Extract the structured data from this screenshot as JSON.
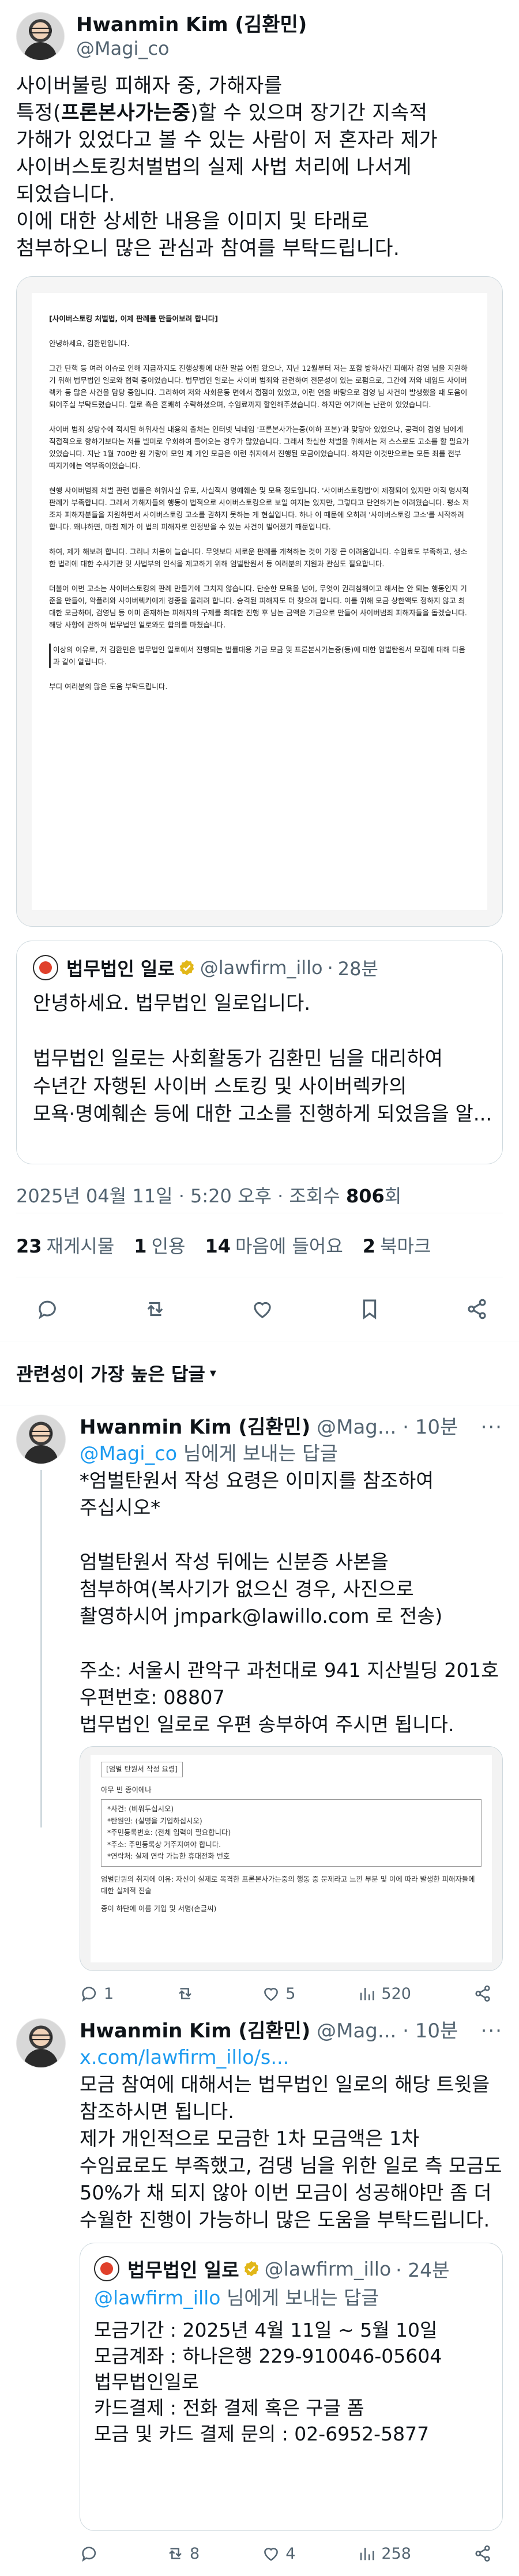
{
  "author": {
    "name": "Hwanmin Kim (김환민)",
    "handle": "@Magi_co"
  },
  "post": {
    "lines": [
      "사이버불링 피해자 중, 가해자를",
      "특정(",
      "가해가 있었다고 볼 수 있는 사람이 저 혼자라 제가",
      "사이버스토킹처벌법의 실제 사법 처리에 나서게",
      "되었습니다.",
      "이에 대한 상세한 내용을 이미지 및 타래로",
      "첨부하오니 많은 관심과 참여를 부탁드립니다."
    ],
    "bold_part": "프론본사가는중",
    "line2_rest": ")할 수 있으며 장기간 지속적"
  },
  "document": {
    "title": "[사이버스토킹 처벌법, 이제 판례를 만들어보려 합니다]",
    "paragraphs": [
      "안녕하세요, 김환민입니다.",
      "그간 탄핵 등 여러 이슈로 인해 지금까지도 진행상황에 대한 말씀 어렵 왔으나, 지난 12월부터 저는 포함 방화사건 피해자 검영 님을 지원하기 위해 법무법인 일로와 협력 중이었습니다. 법무법인 일로는 사이버 범죄와 관련하여 전문성이 있는 로펌으로, 그간에 저와 네임드 사이버렉카 등 많은 사건을 담당 중입니다. 그리하여 저와 사회운동 면에서 접점이 있었고, 이런 연을 바탕으로 검영 님 사건이 발생했을 때 도움이 되어주실 부탁드렸습니다. 일로 측은 흔쾌히 수락하셨으며, 수임료까지 할인해주셨습니다. 하지만 여기에는 난관이 있었습니다.",
      "사이버 범죄 상당수에 적시된 허위사실 내용의 출처는 인터넷 닉네임 '프론본사가는중(이하 프본)'과 맞닿아 있었으나, 공격이 검영 님에게 직접적으로 향하기보다는 저를 빌미로 우회하여 들어오는 경우가 많았습니다. 그래서 확실한 처벌을 위해서는 저 스스로도 고소를 할 필요가 있었습니다. 지난 1월 700만 원 가량이 모인 제 개인 모금은 이런 취지에서 진행된 모금이었습니다. 하지만 이것만으로는 모든 죄를 전부 따지기에는 역부족이었습니다.",
      "현행 사이버범죄 처벌 관련 법률은 허위사실 유포, 사실적시 명예훼손 및 모욕 정도입니다. '사이버스토킹법'이 제정되어 있지만 아직 명시적 판례가 부족합니다. 그래서 가해자들의 행동이 법적으로 사이버스토킹으로 보일 여지는 있지만, 그렇다고 단언하기는 어려웠습니다. 평소 저조차 피해자분들을 지원하면서 사이버스토킹 고소를 권하지 못하는 게 현실입니다. 하나 이 때문에 오히려 '사이버스토킹 고소'를 시작하려 합니다. 왜냐하면, 마침 제가 이 법의 피해자로 인정받을 수 있는 사건이 벌어졌기 때문입니다.",
      "하여, 제가 해보려 합니다. 그러나 처음이 늘습니다. 무엇보다 새로운 판례를 개척하는 것이 가장 큰 어려움입니다. 수임료도 부족하고, 생소한 법리에 대한 수사기관 및 사법부의 인식을 제고하기 위해 엄벌탄원서 등 여러분의 지원과 관심도 필요합니다.",
      "더불어 이번 고소는 사이버스토킹의 판례 만들기에 그치지 않습니다. 단순한 모욕을 넘어, 무엇이 권리침해이고 해서는 안 되는 행동인지 기준을 만들어, 악플러와 사이버렉카에게 경종을 울리려 합니다. 승격된 피해자도 더 찾으려 합니다. 이를 위해 모금 상한액도 정하지 않고 최대한 모금하며, 검영님 등 이미 존재하는 피해자의 구제를 최대한 진행 후 남는 금액은 기금으로 만들어 사이버범죄 피해자들을 돕겠습니다. 해당 사항에 관하여 법무법인 일로와도 합의를 마쳤습니다.",
      "이상의 이유로, 저 김환민은 법무법인 일로에서 진행되는 법률대응 기금 모금 및 프론본사가는중(등)에 대한 엄벌탄원서 모집에 대해 다음과 같이 알립니다.",
      "부디 여러분의 많은 도움 부탁드립니다."
    ]
  },
  "quote_tweet": {
    "name": "법무법인 일로",
    "handle": "@lawfirm_illo",
    "time": "28분",
    "lines": [
      "안녕하세요. 법무법인 일로입니다.",
      "법무법인 일로는 사회활동가 김환민 님을 대리하여",
      "수년간 자행된 사이버 스토킹 및 사이버렉카의",
      "모욕·명예훼손 등에 대한 고소를 진행하게 되었음을 알..."
    ]
  },
  "timestamp": {
    "text": "2025년 04월 11일 · 5:20 오후 · 조회수 ",
    "views": "806",
    "views_suffix": "회"
  },
  "stats": [
    {
      "count": "23",
      "label": "재게시물"
    },
    {
      "count": "1",
      "label": "인용"
    },
    {
      "count": "14",
      "label": "마음에 들어요"
    },
    {
      "count": "2",
      "label": "북마크"
    }
  ],
  "sort_label": "관련성이 가장 높은 답글",
  "replies": [
    {
      "name": "Hwanmin Kim (김환민)",
      "handle": "@Mag...",
      "time": "· 10분",
      "reply_to": "@Magi_co",
      "reply_suffix": " 님에게 보내는 답글",
      "lines": [
        "*엄벌탄원서 작성 요령은 이미지를 참조하여",
        "주십시오*",
        "",
        "엄벌탄원서 작성 뒤에는 신분증 사본을",
        "첨부하여(복사기가 없으신 경우, 사진으로",
        "촬영하시어 jmpark@lawillo.com 로 전송)",
        "",
        "주소: 서울시 관악구 과천대로 941 지산빌딩 201호",
        "우편번호: 08807",
        "법무법인 일로로 우편 송부하여 주시면 됩니다."
      ],
      "form": {
        "title": "[엄벌 탄원서 작성 요령]",
        "lines": [
          "아무 빈 종이에나",
          "*사건: (비워두십시오)",
          "*탄원인: (실명을 기입하십시오)",
          "*주민등록번호: (전체 입력이 필요합니다)",
          "*주소: 주민등록상 거주지여야 합니다.",
          "*연락처: 실제 연락 가능한 휴대전화 번호",
          "엄벌탄원의 취지에 이유: 자신이 실제로 목격한 프론본사가는중의 행동 중 문제라고 느낀 부분 및 이에 따라 발생한 피해자들에 대한 실제적 진술",
          "종이 하단에 이름 기입 및 서명(손글씨)"
        ]
      },
      "actions": {
        "reply": "1",
        "retweet": "",
        "like": "5",
        "views": "520"
      }
    },
    {
      "name": "Hwanmin Kim (김환민)",
      "handle": "@Mag...",
      "time": "· 10분",
      "link": "x.com/lawfirm_illo/s...",
      "lines": [
        "모금 참여에 대해서는 법무법인 일로의 해당 트윗을",
        "참조하시면 됩니다.",
        "제가 개인적으로 모금한 1차 모금액은 1차",
        "수임료로도 부족했고, 검댕 님을 위한 일로 측 모금도",
        "50%가 채 되지 않아 이번 모금이 성공해야만 좀 더",
        "수월한 진행이 가능하니 많은 도움을 부탁드립니다."
      ],
      "inner_quote": {
        "name": "법무법인 일로",
        "handle": "@lawfirm_illo",
        "time": "· 24분",
        "reply_to": "@lawfirm_illo",
        "reply_suffix": " 님에게 보내는 답글",
        "lines": [
          "모금기간 : 2025년 4월 11일 ~ 5월 10일",
          "모금계좌 : 하나은행 229-910046-05604",
          "법무법인일로",
          "카드결제 : 전화 결제 혹은 구글 폼",
          "모금 및 카드 결제 문의 : 02-6952-5877"
        ]
      },
      "actions": {
        "reply": "",
        "retweet": "8",
        "like": "4",
        "views": "258"
      }
    }
  ],
  "icons": [
    "reply-icon",
    "retweet-icon",
    "heart-icon",
    "bookmark-icon",
    "share-icon",
    "views-icon",
    "verified-icon",
    "more-icon"
  ],
  "colors": {
    "accent": "#1d9bf0",
    "muted": "#536471",
    "border": "#cfd9de",
    "gold_badge": "#e2b719"
  }
}
